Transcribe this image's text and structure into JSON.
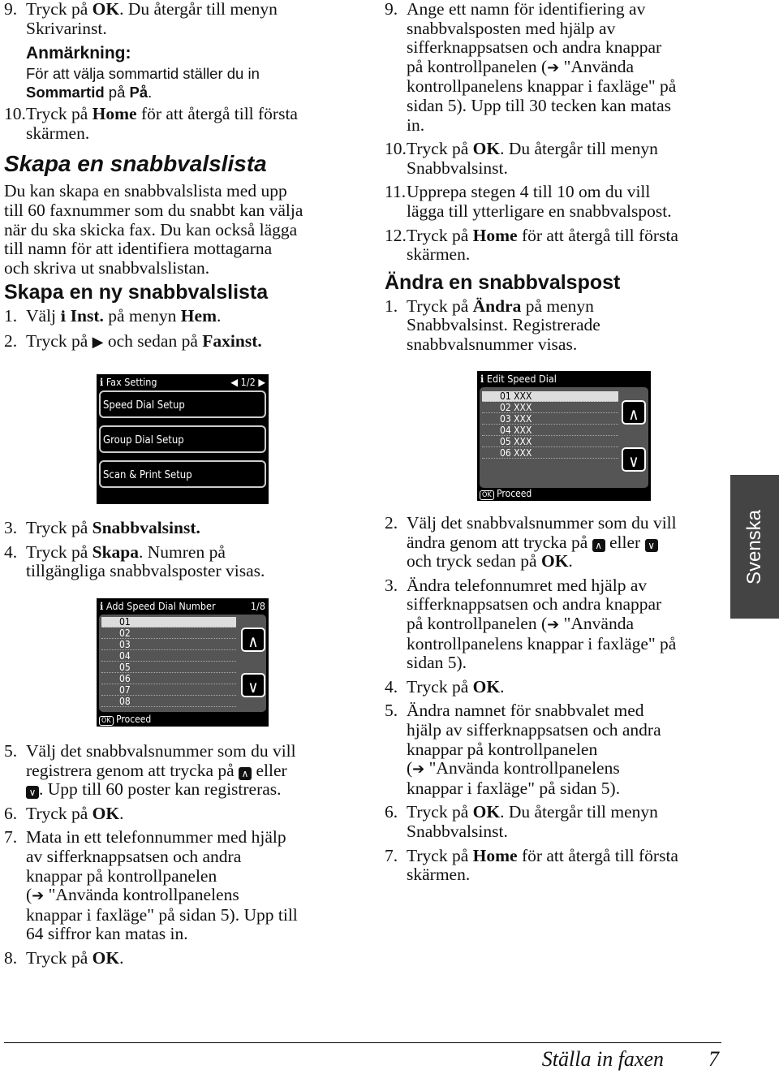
{
  "columns": {
    "left_top": [
      {
        "type": "step",
        "num": "9.",
        "lines": [
          "Tryck på **OK**. Du återgår till menyn",
          "Skrivarinst."
        ]
      },
      {
        "type": "notehead",
        "lines": [
          "Anmärkning:"
        ]
      },
      {
        "type": "note",
        "lines": [
          "För att välja sommartid ställer du in",
          "**Sommartid** på **På**."
        ]
      },
      {
        "type": "step",
        "num": "10.",
        "lines": [
          "Tryck på **Home** för att återgå till första",
          "skärmen."
        ]
      },
      {
        "type": "h1",
        "lines": [
          "Skapa en snabbvalslista"
        ]
      },
      {
        "type": "body",
        "lines": [
          "Du kan skapa en snabbvalslista med upp",
          "till 60 faxnummer som du snabbt kan välja",
          "när du ska skicka fax. Du kan också lägga",
          "till namn för att identifiera mottagarna",
          "och skriva ut snabbvalslistan."
        ]
      },
      {
        "type": "h2",
        "lines": [
          "Skapa en ny snabbvalslista"
        ]
      },
      {
        "type": "step",
        "num": "1.",
        "lines": [
          "Välj {wrench} **Inst.** på menyn **Hem**."
        ]
      },
      {
        "type": "step",
        "num": "2.",
        "lines": [
          "Tryck på {right} och sedan på **Faxinst.**"
        ]
      }
    ],
    "left_bottom": [
      {
        "type": "step",
        "num": "3.",
        "lines": [
          "Tryck på **Snabbvalsinst.**"
        ]
      },
      {
        "type": "step",
        "num": "4.",
        "lines": [
          "Tryck på **Skapa**. Numren på",
          "tillgängliga snabbvalsposter visas."
        ]
      }
    ],
    "left_bottom2": [
      {
        "type": "step",
        "num": "5.",
        "lines": [
          "Välj det snabbvalsnummer som du vill",
          "registrera genom att trycka på {up} eller",
          "{down}. Upp till 60 poster kan registreras."
        ]
      },
      {
        "type": "step",
        "num": "6.",
        "lines": [
          "Tryck på **OK**."
        ]
      },
      {
        "type": "step",
        "num": "7.",
        "lines": [
          "Mata in ett telefonnummer med hjälp",
          "av sifferknappsatsen och andra",
          "knappar på kontrollpanelen",
          "({arrow} \"Använda kontrollpanelens",
          "knappar i faxläge\" på sidan 5). Upp till",
          "64 siffror kan matas in."
        ]
      },
      {
        "type": "step",
        "num": "8.",
        "lines": [
          "Tryck på **OK**."
        ]
      }
    ],
    "right_top": [
      {
        "type": "step",
        "num": "9.",
        "lines": [
          "Ange ett namn för identifiering av",
          "snabbvalsposten med hjälp av",
          "sifferknappsatsen och andra knappar",
          "på kontrollpanelen ({arrow} \"Använda",
          "kontrollpanelens knappar i faxläge\" på",
          "sidan 5). Upp till 30 tecken kan matas",
          "in."
        ]
      },
      {
        "type": "step",
        "num": "10.",
        "lines": [
          "Tryck på **OK**. Du återgår till menyn",
          "Snabbvalsinst."
        ]
      },
      {
        "type": "step",
        "num": "11.",
        "lines": [
          "Upprepa stegen 4 till 10 om du vill",
          "lägga till ytterligare en snabbvalspost."
        ]
      },
      {
        "type": "step",
        "num": "12.",
        "lines": [
          "Tryck på **Home** för att återgå till första",
          "skärmen."
        ]
      },
      {
        "type": "h2",
        "lines": [
          "Ändra en snabbvalspost"
        ]
      },
      {
        "type": "step",
        "num": "1.",
        "lines": [
          "Tryck på **Ändra** på menyn",
          "Snabbvalsinst. Registrerade",
          "snabbvalsnummer visas."
        ]
      }
    ],
    "right_bottom": [
      {
        "type": "step",
        "num": "2.",
        "lines": [
          "Välj det snabbvalsnummer som du vill",
          "ändra genom att trycka på {up} eller {down}",
          "och tryck sedan på **OK**."
        ]
      },
      {
        "type": "step",
        "num": "3.",
        "lines": [
          "Ändra telefonnumret med hjälp av",
          "sifferknappsatsen och andra knappar",
          "på kontrollpanelen ({arrow} \"Använda",
          "kontrollpanelens knappar i faxläge\" på",
          "sidan 5)."
        ]
      },
      {
        "type": "step",
        "num": "4.",
        "lines": [
          "Tryck på **OK**."
        ]
      },
      {
        "type": "step",
        "num": "5.",
        "lines": [
          "Ändra namnet för snabbvalet med",
          "hjälp av sifferknappsatsen och andra",
          "knappar på kontrollpanelen",
          "({arrow} \"Använda kontrollpanelens",
          "knappar i faxläge\" på sidan 5)."
        ]
      },
      {
        "type": "step",
        "num": "6.",
        "lines": [
          "Tryck på **OK**. Du återgår till menyn",
          "Snabbvalsinst."
        ]
      },
      {
        "type": "step",
        "num": "7.",
        "lines": [
          "Tryck på **Home** för att återgå till första",
          "skärmen."
        ]
      }
    ]
  },
  "screens": {
    "fax_setting": {
      "title": "Fax Setting",
      "page": "1/2",
      "buttons": [
        "Speed Dial Setup",
        "Group Dial Setup",
        "Scan & Print Setup"
      ]
    },
    "edit_speed_dial": {
      "title": "Edit Speed Dial",
      "rows": [
        "01 XXX",
        "02 XXX",
        "03 XXX",
        "04 XXX",
        "05 XXX",
        "06 XXX"
      ],
      "ok": "OK",
      "footer": "Proceed"
    },
    "add_speed_dial": {
      "title": "Add Speed Dial Number",
      "page": "1/8",
      "rows": [
        "01",
        "02",
        "03",
        "04",
        "05",
        "06",
        "07",
        "08"
      ],
      "ok": "OK",
      "footer": "Proceed"
    }
  },
  "icons": {
    "wrench": "wrench-icon",
    "right": "right-triangle-icon",
    "up": "up-button-icon",
    "down": "down-button-icon",
    "arrow": "reference-arrow-icon"
  },
  "side_tab": "Svenska",
  "footer": {
    "title": "Ställa in faxen",
    "page": "7"
  }
}
